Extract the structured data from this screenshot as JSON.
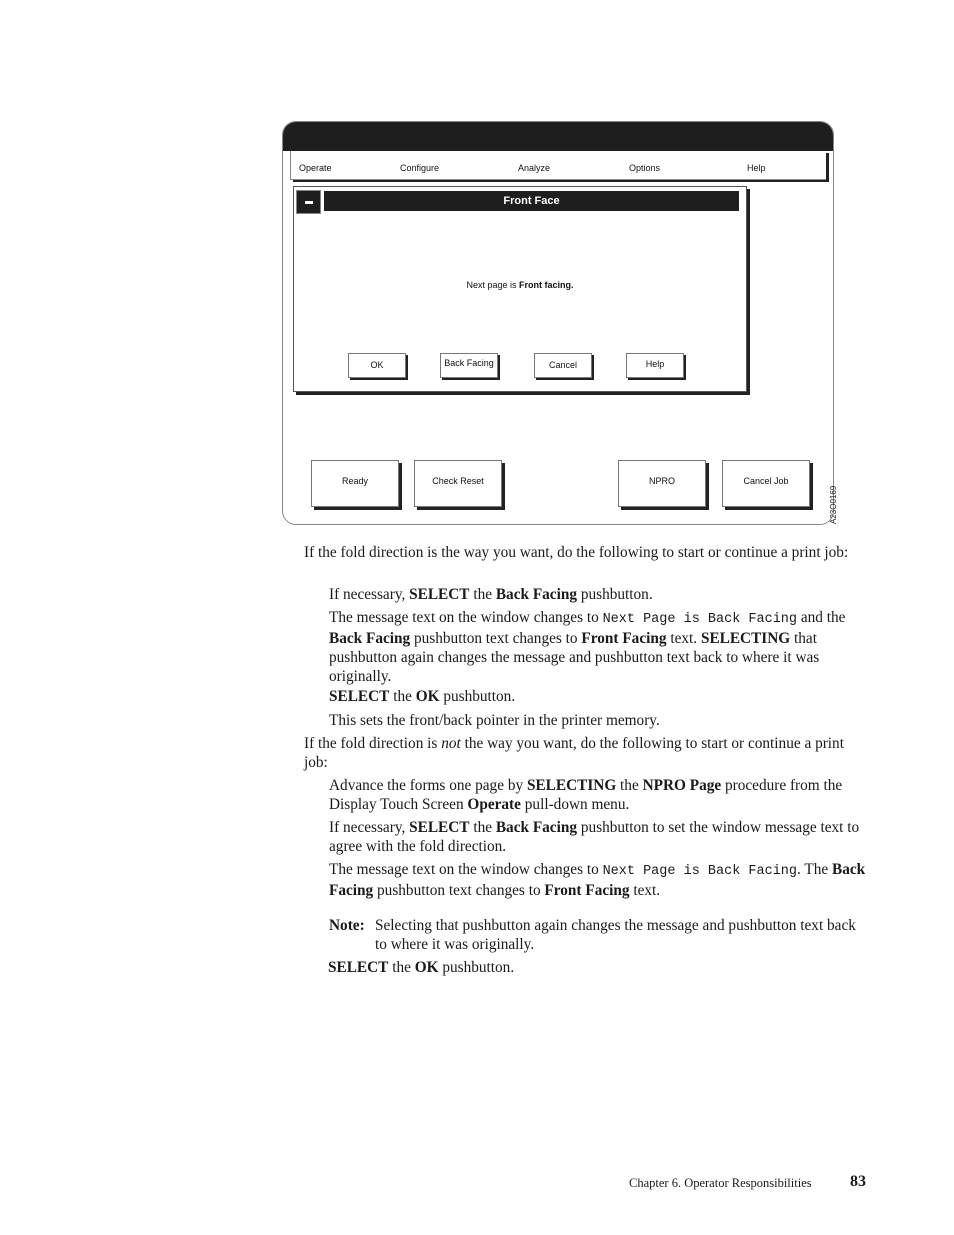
{
  "figure": {
    "menubar": [
      "Operate",
      "Configure",
      "Analyze",
      "Options",
      "Help"
    ],
    "dialog": {
      "title": "Front Face",
      "message_prefix": "Next page is",
      "message_value": "Front facing.",
      "buttons": [
        "OK",
        "Back Facing",
        "Cancel",
        "Help"
      ]
    },
    "bottom_buttons": [
      "Ready",
      "Check Reset",
      "NPRO",
      "Cancel Job"
    ],
    "figure_id": "A23O0169"
  },
  "text": {
    "p1": "If the fold direction is the way you want, do the following to start or continue a print job:",
    "s1": {
      "a": "If necessary, ",
      "b": "SELECT",
      "c": " the ",
      "d": "Back Facing",
      "e": " pushbutton."
    },
    "s2": {
      "a": "The message text on the window changes to ",
      "code": "Next Page is Back Facing",
      "b": " and the ",
      "c": "Back Facing",
      "d": " pushbutton text changes to ",
      "e": "Front Facing",
      "f": " text. ",
      "g": "SELECTING",
      "h": " that pushbutton again changes the message and pushbutton text back to where it was originally."
    },
    "s3": {
      "a": "SELECT",
      "b": " the ",
      "c": "OK",
      "d": " pushbutton."
    },
    "s4": "This sets the front/back pointer in the printer memory.",
    "p2": {
      "a": "If the fold direction is ",
      "i": "not",
      "b": " the way you want, do the following to start or continue a print job:"
    },
    "t1": {
      "a": "Advance the forms one page by ",
      "b": "SELECTING",
      "c": " the ",
      "d": "NPRO Page",
      "e": " procedure from the Display Touch Screen ",
      "f": "Operate",
      "g": " pull-down menu."
    },
    "t2": {
      "a": "If necessary, ",
      "b": "SELECT",
      "c": " the ",
      "d": "Back Facing",
      "e": " pushbutton to set the window message text to agree with the fold direction."
    },
    "t3": {
      "a": "The message text on the window changes to ",
      "code": "Next Page is Back Facing",
      "b": ". The ",
      "c": "Back Facing",
      "d": " pushbutton text changes to ",
      "e": "Front Facing",
      "f": " text."
    },
    "note": {
      "label": "Note:",
      "text": "Selecting that pushbutton again changes the message and pushbutton text back to where it was originally."
    },
    "t4": {
      "a": "SELECT",
      "b": " the ",
      "c": "OK",
      "d": " pushbutton."
    }
  },
  "footer": {
    "chapter": "Chapter 6. Operator Responsibilities",
    "page": "83"
  }
}
